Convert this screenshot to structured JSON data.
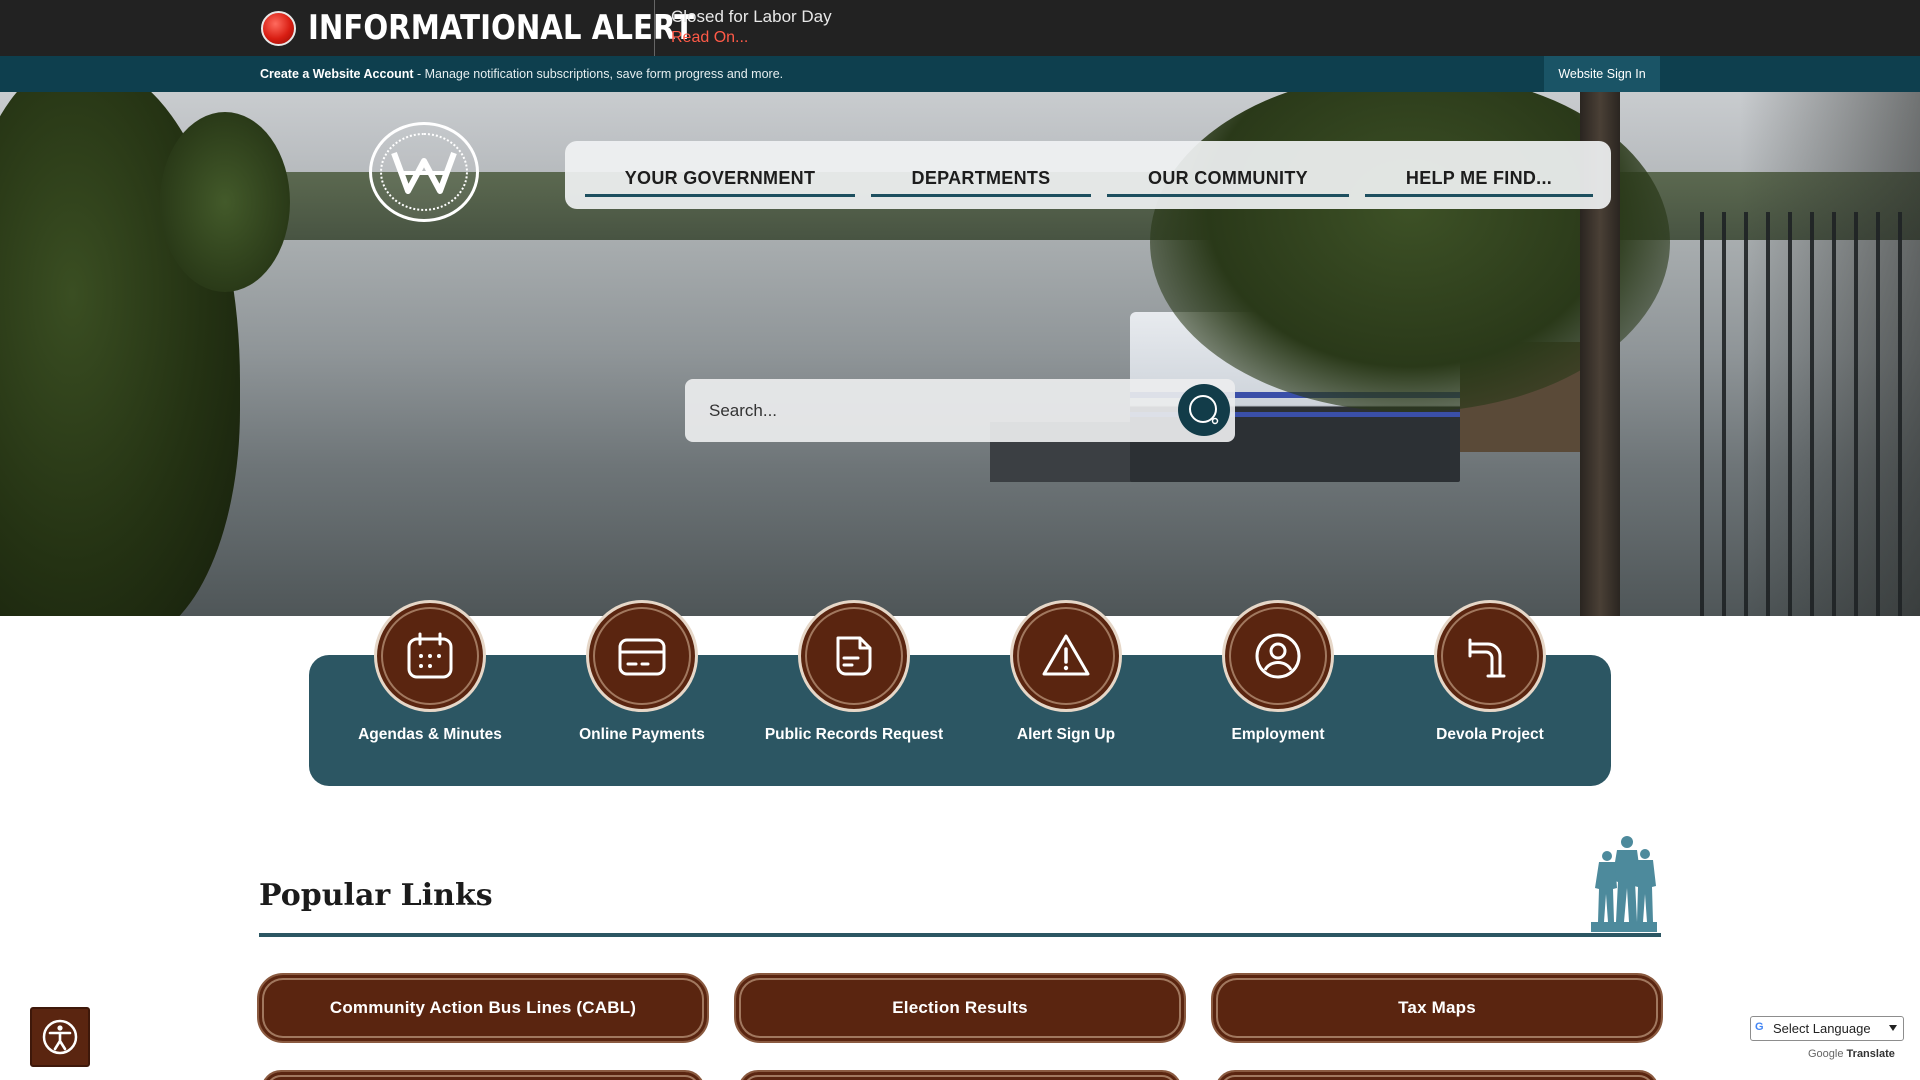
{
  "alert": {
    "title": "INFORMATIONAL ALERT",
    "message": "Closed for Labor Day",
    "link": "Read On..."
  },
  "account": {
    "create_label": "Create a Website Account",
    "description": " - Manage notification subscriptions, save form progress and more.",
    "signin_label": "Website Sign In"
  },
  "nav": {
    "items": [
      {
        "label": "YOUR GOVERNMENT"
      },
      {
        "label": "DEPARTMENTS"
      },
      {
        "label": "OUR COMMUNITY"
      },
      {
        "label": "HELP ME FIND..."
      }
    ]
  },
  "search": {
    "placeholder": "Search..."
  },
  "quick_links": [
    {
      "label": "Agendas & Minutes",
      "icon": "calendar-icon"
    },
    {
      "label": "Online Payments",
      "icon": "credit-card-icon"
    },
    {
      "label": "Public Records Request",
      "icon": "document-icon"
    },
    {
      "label": "Alert Sign Up",
      "icon": "warning-icon"
    },
    {
      "label": "Employment",
      "icon": "user-icon"
    },
    {
      "label": "Devola Project",
      "icon": "pipe-icon"
    }
  ],
  "popular": {
    "title": "Popular Links",
    "links": [
      {
        "label": "Community Action Bus Lines (CABL)"
      },
      {
        "label": "Election Results"
      },
      {
        "label": "Tax Maps"
      }
    ]
  },
  "translate": {
    "select_label": "Select Language",
    "powered_by": "Google",
    "translate_label": "Translate"
  },
  "colors": {
    "alert_bg": "#222222",
    "account_bg": "#0e3f4e",
    "accent_teal": "#2c5663",
    "brown": "#5a2510",
    "alert_link": "#ff5a47"
  }
}
